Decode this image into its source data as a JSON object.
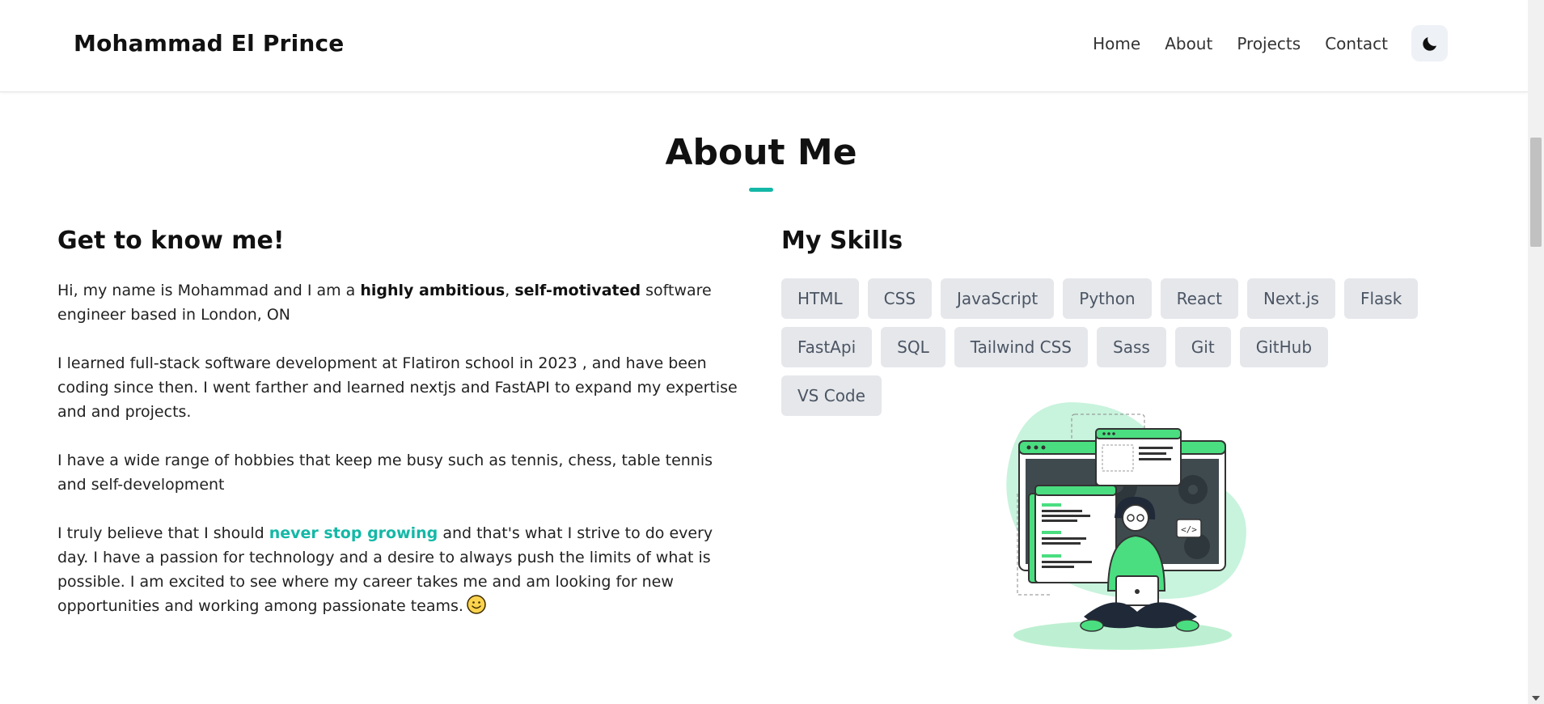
{
  "brand": "Mohammad El Prince",
  "nav": {
    "links": [
      "Home",
      "About",
      "Projects",
      "Contact"
    ]
  },
  "about": {
    "title": "About Me",
    "left": {
      "heading": "Get to know me!",
      "p1_a": "Hi, my name is Mohammad and I am a ",
      "p1_b": "highly ambitious",
      "p1_c": ", ",
      "p1_d": "self-motivated",
      "p1_e": " software engineer based in London, ON",
      "p2": "I learned full-stack software development at Flatiron school in 2023 , and have been coding since then. I went farther and learned nextjs and FastAPI to expand my expertise and and projects.",
      "p3": "I have a wide range of hobbies that keep me busy such as tennis, chess, table tennis and self-development",
      "p4_a": "I truly believe that I should ",
      "p4_b": "never stop growing",
      "p4_c": " and that's what I strive to do every day. I have a passion for technology and a desire to always push the limits of what is possible. I am excited to see where my career takes me and am looking for new opportunities and working among passionate teams."
    },
    "right": {
      "heading": "My Skills",
      "skills": [
        "HTML",
        "CSS",
        "JavaScript",
        "Python",
        "React",
        "Next.js",
        "Flask",
        "FastApi",
        "SQL",
        "Tailwind CSS",
        "Sass",
        "Git",
        "GitHub",
        "VS Code"
      ]
    }
  },
  "colors": {
    "accent": "#14b8a6",
    "skill_bg": "#e5e7eb",
    "skill_text": "#4b5563",
    "illustration_green": "#4ade80"
  },
  "icons": {
    "theme_toggle": "moon-icon",
    "emoji": "smile-emoji-icon",
    "illustration": "developer-illustration"
  }
}
